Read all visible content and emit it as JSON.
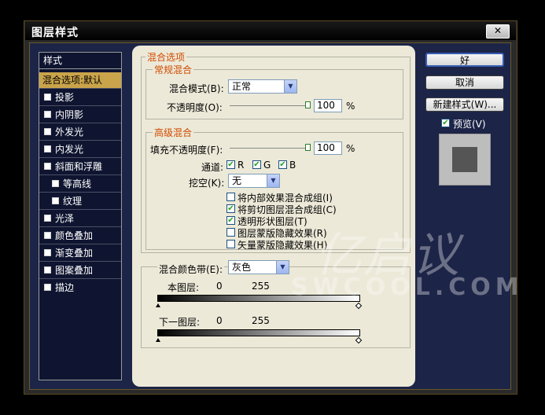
{
  "window": {
    "title": "图层样式",
    "close_glyph": "✕"
  },
  "style_list": {
    "header": "样式",
    "items": [
      {
        "label": "混合选项:默认",
        "checkbox": false,
        "selected": true,
        "indent": 0
      },
      {
        "label": "投影",
        "checkbox": true,
        "indent": 0
      },
      {
        "label": "内阴影",
        "checkbox": true,
        "indent": 0
      },
      {
        "label": "外发光",
        "checkbox": true,
        "indent": 0
      },
      {
        "label": "内发光",
        "checkbox": true,
        "indent": 0
      },
      {
        "label": "斜面和浮雕",
        "checkbox": true,
        "indent": 0
      },
      {
        "label": "等高线",
        "checkbox": true,
        "indent": 1
      },
      {
        "label": "纹理",
        "checkbox": true,
        "indent": 1
      },
      {
        "label": "光泽",
        "checkbox": true,
        "indent": 0
      },
      {
        "label": "颜色叠加",
        "checkbox": true,
        "indent": 0
      },
      {
        "label": "渐变叠加",
        "checkbox": true,
        "indent": 0
      },
      {
        "label": "图案叠加",
        "checkbox": true,
        "indent": 0
      },
      {
        "label": "描边",
        "checkbox": true,
        "indent": 0
      }
    ]
  },
  "blend_options": {
    "section_title": "混合选项",
    "general": {
      "title": "常规混合",
      "mode_label": "混合模式(B):",
      "mode_value": "正常",
      "opacity_label": "不透明度(O):",
      "opacity_value": "100",
      "opacity_unit": "%"
    },
    "advanced": {
      "title": "高级混合",
      "fill_label": "填充不透明度(F):",
      "fill_value": "100",
      "fill_unit": "%",
      "channels_label": "通道:",
      "channels": [
        {
          "name": "R",
          "checked": true
        },
        {
          "name": "G",
          "checked": true
        },
        {
          "name": "B",
          "checked": true
        }
      ],
      "knockout_label": "挖空(K):",
      "knockout_value": "无",
      "options": [
        {
          "label": "将内部效果混合成组(I)",
          "checked": false
        },
        {
          "label": "将剪切图层混合成组(C)",
          "checked": true
        },
        {
          "label": "透明形状图层(T)",
          "checked": true
        },
        {
          "label": "图层蒙版隐藏效果(R)",
          "checked": false
        },
        {
          "label": "矢量蒙版隐藏效果(H)",
          "checked": false
        }
      ]
    },
    "blend_if": {
      "label": "混合颜色带(E):",
      "value": "灰色",
      "this_layer_label": "本图层:",
      "this_layer_min": "0",
      "this_layer_max": "255",
      "under_layer_label": "下一图层:",
      "under_layer_min": "0",
      "under_layer_max": "255"
    }
  },
  "buttons": {
    "ok": "好",
    "cancel": "取消",
    "new_style": "新建样式(W)...",
    "preview_label": "预览(V)",
    "preview_checked": true
  },
  "watermark": {
    "logo": "亿启议",
    "text": "SWCOOL.COM"
  },
  "colors": {
    "selection": "#c9a44a",
    "group_title": "#d24a00",
    "list_bg": "#0f1530",
    "panel_bg": "#ece9d8"
  }
}
